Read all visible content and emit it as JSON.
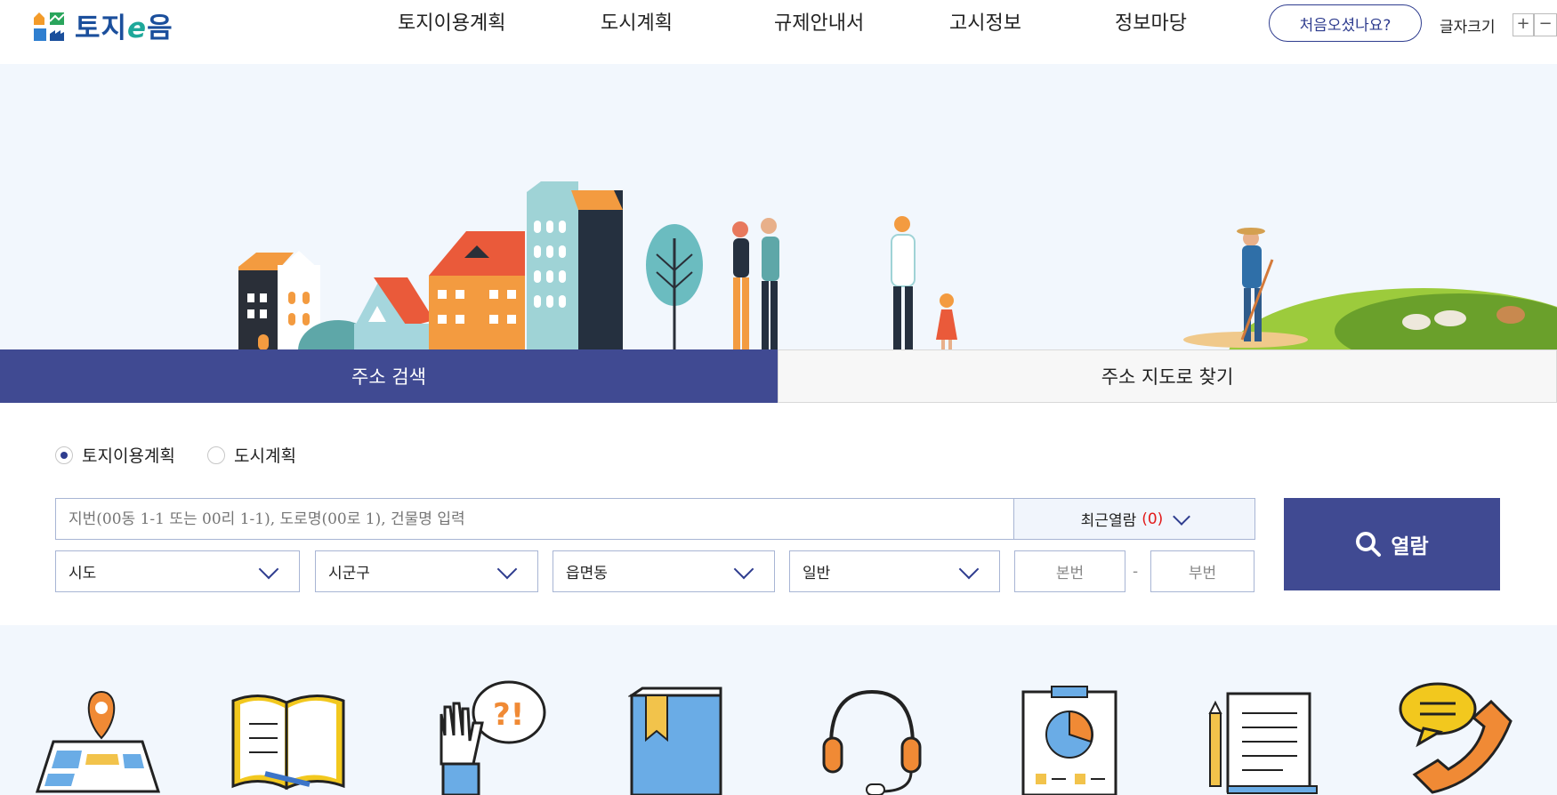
{
  "header": {
    "logo_text": "토지",
    "logo_e": "e",
    "logo_text2": "음",
    "nav": [
      "토지이용계획",
      "도시계획",
      "규제안내서",
      "고시정보",
      "정보마당"
    ],
    "first_visit_label": "처음오셨나요?",
    "font_size_label": "글자크기",
    "font_plus": "+",
    "font_minus": "−"
  },
  "tabs": {
    "active_label": "주소 검색",
    "inactive_label": "주소 지도로 찾기"
  },
  "search": {
    "radio_options": [
      {
        "label": "토지이용계획",
        "selected": true
      },
      {
        "label": "도시계획",
        "selected": false
      }
    ],
    "input_placeholder": "지번(00동 1-1 또는 00리 1-1), 도로명(00로 1), 건물명 입력",
    "recent_label": "최근열람",
    "recent_count": "(0)",
    "selects": [
      "시도",
      "시군구",
      "읍면동",
      "일반"
    ],
    "main_number_placeholder": "본번",
    "sub_number_placeholder": "부번",
    "dash": "-",
    "view_button_label": "열람"
  },
  "quick_icons": [
    "map-pin-icon",
    "open-book-icon",
    "question-hand-icon",
    "bookmark-book-icon",
    "headset-icon",
    "pie-chart-board-icon",
    "document-scroll-icon",
    "phone-chat-icon"
  ],
  "colors": {
    "primary": "#404a92",
    "accent_red": "#e21b1b",
    "background": "#f2f7fd"
  }
}
